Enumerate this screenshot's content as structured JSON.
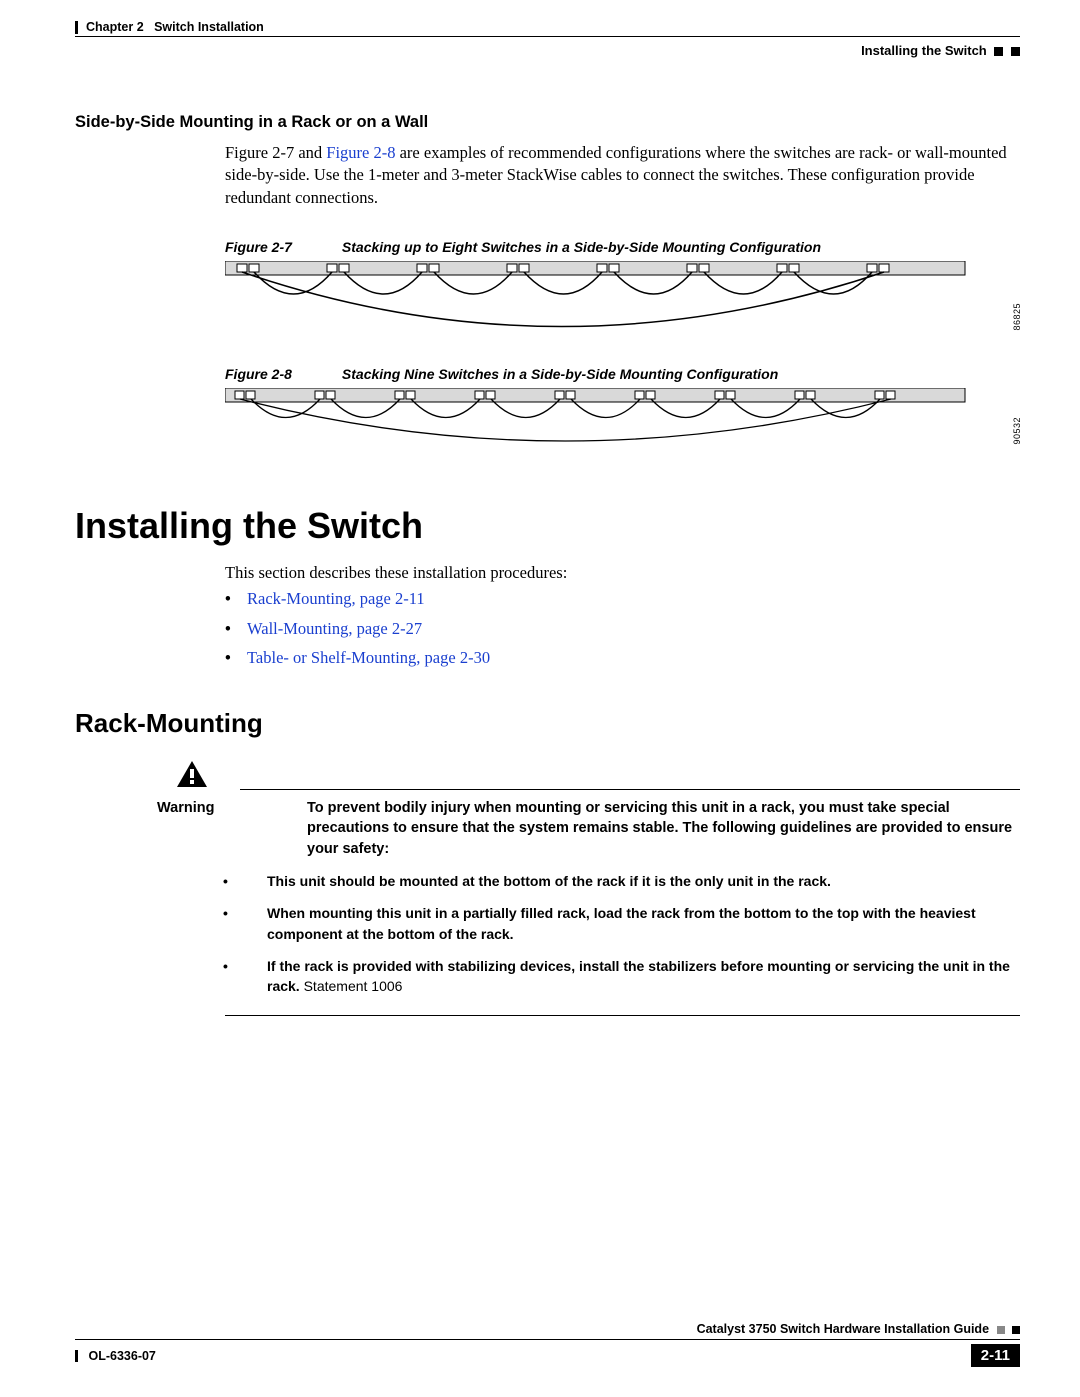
{
  "header": {
    "chapter": "Chapter 2",
    "title": "Switch Installation",
    "running": "Installing the Switch"
  },
  "section": {
    "sidebyside_heading": "Side-by-Side Mounting in a Rack or on a Wall",
    "sidebyside_text_pre": "Figure 2-7 and ",
    "sidebyside_fig28_link": "Figure 2-8",
    "sidebyside_text_post": " are examples of recommended configurations where the switches are rack- or wall-mounted side-by-side. Use the 1-meter and 3-meter StackWise cables to connect the switches. These configuration provide redundant connections."
  },
  "figures": {
    "fig27_label": "Figure 2-7",
    "fig27_title": "Stacking up to Eight Switches in a Side-by-Side Mounting Configuration",
    "fig27_id": "86825",
    "fig28_label": "Figure 2-8",
    "fig28_title": "Stacking Nine Switches in a Side-by-Side Mounting Configuration",
    "fig28_id": "90532"
  },
  "installing": {
    "heading": "Installing the Switch",
    "intro": "This section describes these installation procedures:",
    "links": [
      "Rack-Mounting, page 2-11",
      "Wall-Mounting, page 2-27",
      "Table- or Shelf-Mounting, page 2-30"
    ]
  },
  "rack": {
    "heading": "Rack-Mounting",
    "warning_label": "Warning",
    "warning_text": "To prevent bodily injury when mounting or servicing this unit in a rack, you must take special precautions to ensure that the system remains stable. The following guidelines are provided to ensure your safety:",
    "items": [
      "This unit should be mounted at the bottom of the rack if it is the only unit in the rack.",
      "When mounting this unit in a partially filled rack, load the rack from the bottom to the top with the heaviest component at the bottom of the rack.",
      "If the rack is provided with stabilizing devices, install the stabilizers before mounting or servicing the unit in the rack."
    ],
    "statement": " Statement 1006"
  },
  "footer": {
    "guide": "Catalyst 3750 Switch Hardware Installation Guide",
    "docnum": "OL-6336-07",
    "pagenum": "2-11"
  }
}
